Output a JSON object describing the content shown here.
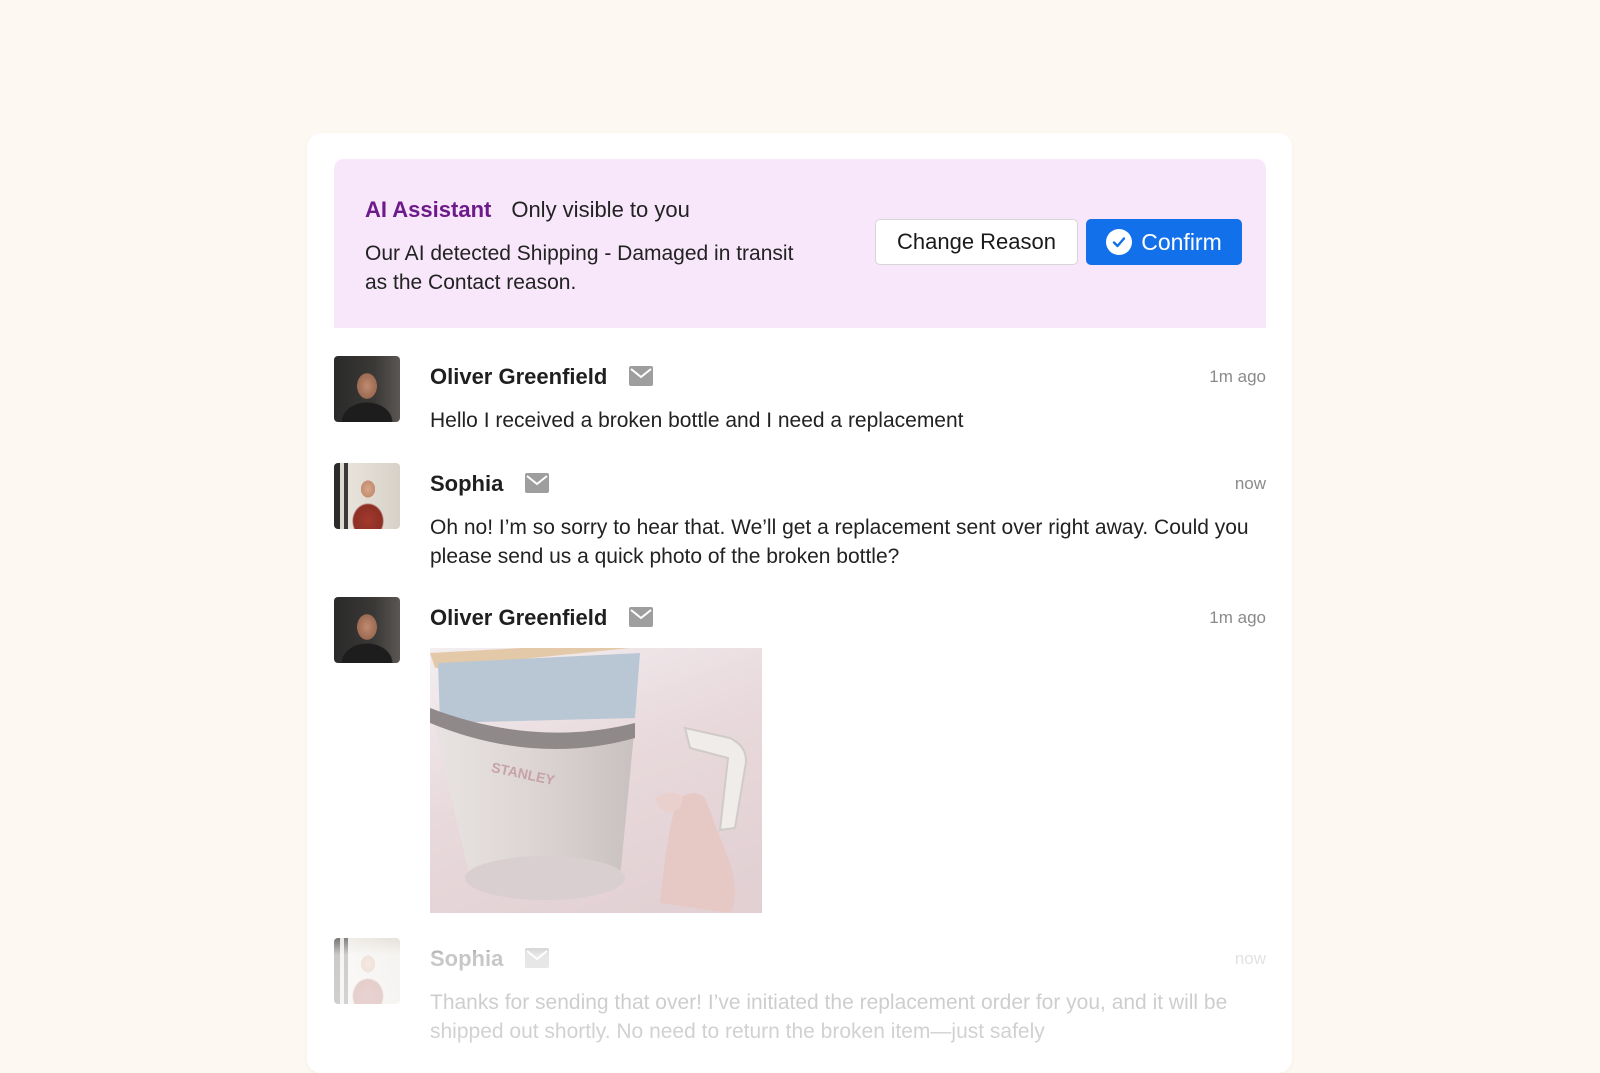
{
  "ai_panel": {
    "label": "AI Assistant",
    "visibility": "Only visible to you",
    "message": "Our AI detected Shipping - Damaged in transit as the Contact reason.",
    "change_reason_label": "Change Reason",
    "confirm_label": "Confirm",
    "background_color": "#f8e6fb",
    "accent_color": "#6d1a8a",
    "confirm_color": "#1271ea"
  },
  "messages": [
    {
      "sender": "Oliver Greenfield",
      "channel_icon": "mail-icon",
      "time": "1m ago",
      "text": "Hello I received a broken bottle and I need a replacement"
    },
    {
      "sender": "Sophia",
      "channel_icon": "mail-icon",
      "time": "now",
      "text": "Oh no! I’m so sorry to hear that. We’ll get a replacement sent over right away. Could you please send us a quick photo of the broken bottle?"
    },
    {
      "sender": "Oliver Greenfield",
      "channel_icon": "mail-icon",
      "time": "1m ago",
      "attachment": "photo of broken tumbler bottle",
      "photo_brand": "STANLEY"
    },
    {
      "sender": "Sophia",
      "channel_icon": "mail-icon",
      "time": "now",
      "text": "Thanks for sending that over! I’ve initiated the replacement order for you, and it will be shipped out shortly. No need to return the broken item—just safely"
    }
  ]
}
